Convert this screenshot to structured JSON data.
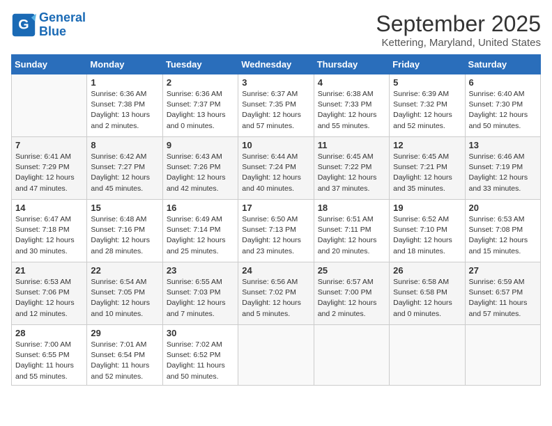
{
  "header": {
    "logo_line1": "General",
    "logo_line2": "Blue",
    "month": "September 2025",
    "location": "Kettering, Maryland, United States"
  },
  "weekdays": [
    "Sunday",
    "Monday",
    "Tuesday",
    "Wednesday",
    "Thursday",
    "Friday",
    "Saturday"
  ],
  "weeks": [
    [
      {
        "day": "",
        "sunrise": "",
        "sunset": "",
        "daylight": ""
      },
      {
        "day": "1",
        "sunrise": "Sunrise: 6:36 AM",
        "sunset": "Sunset: 7:38 PM",
        "daylight": "Daylight: 13 hours and 2 minutes."
      },
      {
        "day": "2",
        "sunrise": "Sunrise: 6:36 AM",
        "sunset": "Sunset: 7:37 PM",
        "daylight": "Daylight: 13 hours and 0 minutes."
      },
      {
        "day": "3",
        "sunrise": "Sunrise: 6:37 AM",
        "sunset": "Sunset: 7:35 PM",
        "daylight": "Daylight: 12 hours and 57 minutes."
      },
      {
        "day": "4",
        "sunrise": "Sunrise: 6:38 AM",
        "sunset": "Sunset: 7:33 PM",
        "daylight": "Daylight: 12 hours and 55 minutes."
      },
      {
        "day": "5",
        "sunrise": "Sunrise: 6:39 AM",
        "sunset": "Sunset: 7:32 PM",
        "daylight": "Daylight: 12 hours and 52 minutes."
      },
      {
        "day": "6",
        "sunrise": "Sunrise: 6:40 AM",
        "sunset": "Sunset: 7:30 PM",
        "daylight": "Daylight: 12 hours and 50 minutes."
      }
    ],
    [
      {
        "day": "7",
        "sunrise": "Sunrise: 6:41 AM",
        "sunset": "Sunset: 7:29 PM",
        "daylight": "Daylight: 12 hours and 47 minutes."
      },
      {
        "day": "8",
        "sunrise": "Sunrise: 6:42 AM",
        "sunset": "Sunset: 7:27 PM",
        "daylight": "Daylight: 12 hours and 45 minutes."
      },
      {
        "day": "9",
        "sunrise": "Sunrise: 6:43 AM",
        "sunset": "Sunset: 7:26 PM",
        "daylight": "Daylight: 12 hours and 42 minutes."
      },
      {
        "day": "10",
        "sunrise": "Sunrise: 6:44 AM",
        "sunset": "Sunset: 7:24 PM",
        "daylight": "Daylight: 12 hours and 40 minutes."
      },
      {
        "day": "11",
        "sunrise": "Sunrise: 6:45 AM",
        "sunset": "Sunset: 7:22 PM",
        "daylight": "Daylight: 12 hours and 37 minutes."
      },
      {
        "day": "12",
        "sunrise": "Sunrise: 6:45 AM",
        "sunset": "Sunset: 7:21 PM",
        "daylight": "Daylight: 12 hours and 35 minutes."
      },
      {
        "day": "13",
        "sunrise": "Sunrise: 6:46 AM",
        "sunset": "Sunset: 7:19 PM",
        "daylight": "Daylight: 12 hours and 33 minutes."
      }
    ],
    [
      {
        "day": "14",
        "sunrise": "Sunrise: 6:47 AM",
        "sunset": "Sunset: 7:18 PM",
        "daylight": "Daylight: 12 hours and 30 minutes."
      },
      {
        "day": "15",
        "sunrise": "Sunrise: 6:48 AM",
        "sunset": "Sunset: 7:16 PM",
        "daylight": "Daylight: 12 hours and 28 minutes."
      },
      {
        "day": "16",
        "sunrise": "Sunrise: 6:49 AM",
        "sunset": "Sunset: 7:14 PM",
        "daylight": "Daylight: 12 hours and 25 minutes."
      },
      {
        "day": "17",
        "sunrise": "Sunrise: 6:50 AM",
        "sunset": "Sunset: 7:13 PM",
        "daylight": "Daylight: 12 hours and 23 minutes."
      },
      {
        "day": "18",
        "sunrise": "Sunrise: 6:51 AM",
        "sunset": "Sunset: 7:11 PM",
        "daylight": "Daylight: 12 hours and 20 minutes."
      },
      {
        "day": "19",
        "sunrise": "Sunrise: 6:52 AM",
        "sunset": "Sunset: 7:10 PM",
        "daylight": "Daylight: 12 hours and 18 minutes."
      },
      {
        "day": "20",
        "sunrise": "Sunrise: 6:53 AM",
        "sunset": "Sunset: 7:08 PM",
        "daylight": "Daylight: 12 hours and 15 minutes."
      }
    ],
    [
      {
        "day": "21",
        "sunrise": "Sunrise: 6:53 AM",
        "sunset": "Sunset: 7:06 PM",
        "daylight": "Daylight: 12 hours and 12 minutes."
      },
      {
        "day": "22",
        "sunrise": "Sunrise: 6:54 AM",
        "sunset": "Sunset: 7:05 PM",
        "daylight": "Daylight: 12 hours and 10 minutes."
      },
      {
        "day": "23",
        "sunrise": "Sunrise: 6:55 AM",
        "sunset": "Sunset: 7:03 PM",
        "daylight": "Daylight: 12 hours and 7 minutes."
      },
      {
        "day": "24",
        "sunrise": "Sunrise: 6:56 AM",
        "sunset": "Sunset: 7:02 PM",
        "daylight": "Daylight: 12 hours and 5 minutes."
      },
      {
        "day": "25",
        "sunrise": "Sunrise: 6:57 AM",
        "sunset": "Sunset: 7:00 PM",
        "daylight": "Daylight: 12 hours and 2 minutes."
      },
      {
        "day": "26",
        "sunrise": "Sunrise: 6:58 AM",
        "sunset": "Sunset: 6:58 PM",
        "daylight": "Daylight: 12 hours and 0 minutes."
      },
      {
        "day": "27",
        "sunrise": "Sunrise: 6:59 AM",
        "sunset": "Sunset: 6:57 PM",
        "daylight": "Daylight: 11 hours and 57 minutes."
      }
    ],
    [
      {
        "day": "28",
        "sunrise": "Sunrise: 7:00 AM",
        "sunset": "Sunset: 6:55 PM",
        "daylight": "Daylight: 11 hours and 55 minutes."
      },
      {
        "day": "29",
        "sunrise": "Sunrise: 7:01 AM",
        "sunset": "Sunset: 6:54 PM",
        "daylight": "Daylight: 11 hours and 52 minutes."
      },
      {
        "day": "30",
        "sunrise": "Sunrise: 7:02 AM",
        "sunset": "Sunset: 6:52 PM",
        "daylight": "Daylight: 11 hours and 50 minutes."
      },
      {
        "day": "",
        "sunrise": "",
        "sunset": "",
        "daylight": ""
      },
      {
        "day": "",
        "sunrise": "",
        "sunset": "",
        "daylight": ""
      },
      {
        "day": "",
        "sunrise": "",
        "sunset": "",
        "daylight": ""
      },
      {
        "day": "",
        "sunrise": "",
        "sunset": "",
        "daylight": ""
      }
    ]
  ]
}
